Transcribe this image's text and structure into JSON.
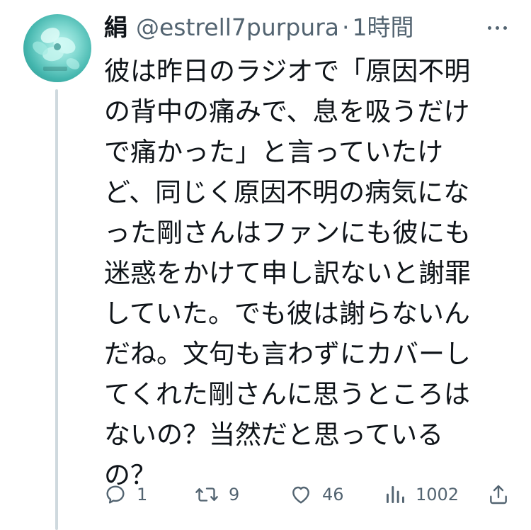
{
  "tweet": {
    "display_name": "絹",
    "handle": "@estrell7purpura",
    "separator": "·",
    "time": "1時間",
    "text_lines": [
      "彼は昨日のラジオで「原因不明",
      "の背中の痛みで、息を吸うだけ",
      "で痛かった」と言っていたけ",
      "ど、同じく原因不明の病気にな",
      "った剛さんはファンにも彼にも",
      "迷惑をかけて申し訳ないと謝罪",
      "していた。でも彼は謝らないん",
      "だね。文句も言わずにカバーし",
      "てくれた剛さんに思うところは",
      "ないの？当然だと思っている",
      "の？"
    ]
  },
  "actions": {
    "replies": "1",
    "retweets": "9",
    "likes": "46",
    "views": "1002"
  },
  "icons": {
    "reply": "reply-icon",
    "retweet": "retweet-icon",
    "like": "heart-icon",
    "views": "analytics-icon",
    "share": "share-icon",
    "more": "more-dots-icon"
  },
  "colors": {
    "text": "#0f1419",
    "secondary": "#536471",
    "thread_line": "#cfd9de",
    "avatar_accent": "#43b5ad"
  }
}
